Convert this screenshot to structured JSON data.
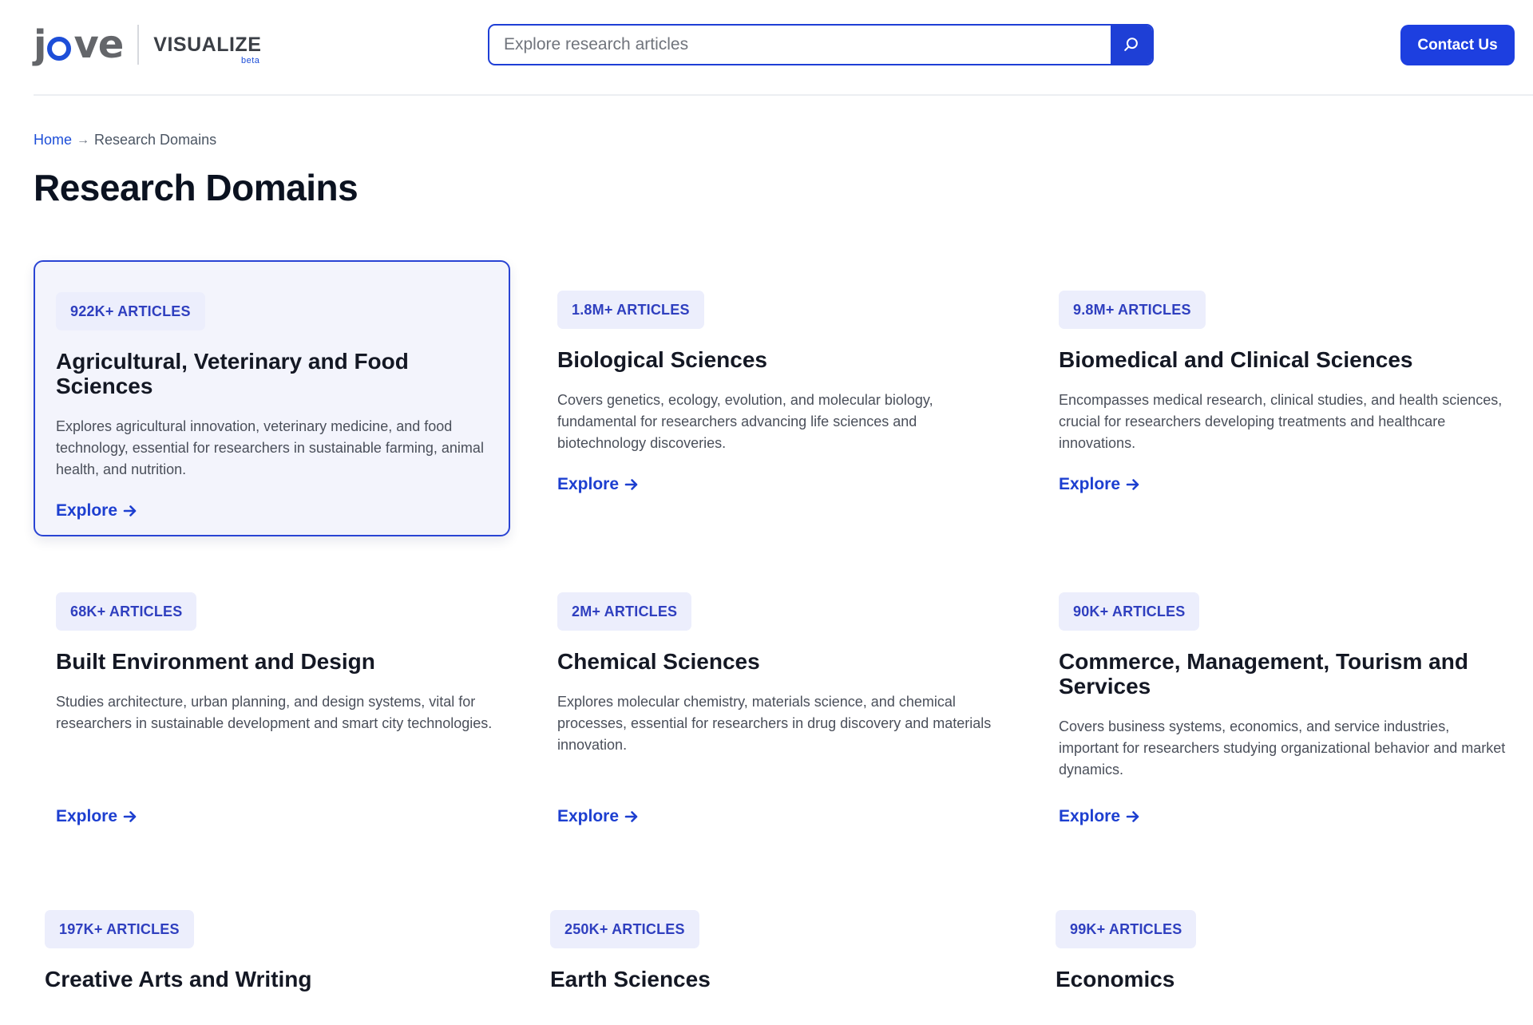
{
  "header": {
    "logo_text_j": "j",
    "logo_text_ve": "ve",
    "logo_product": "VISUALIZE",
    "logo_beta": "beta",
    "search_placeholder": "Explore research articles",
    "contact_label": "Contact Us"
  },
  "breadcrumb": {
    "home": "Home",
    "current": "Research Domains"
  },
  "page_title": "Research Domains",
  "explore_label": "Explore",
  "colors": {
    "accent": "#1d3fe0",
    "badge_bg": "#eceefc",
    "active_card_bg": "#f3f4fc"
  },
  "domains": [
    {
      "badge": "922K+ ARTICLES",
      "title": "Agricultural, Veterinary and Food Sciences",
      "description": "Explores agricultural innovation, veterinary medicine, and food technology, essential for researchers in sustainable farming, animal health, and nutrition."
    },
    {
      "badge": "1.8M+ ARTICLES",
      "title": "Biological Sciences",
      "description": "Covers genetics, ecology, evolution, and molecular biology, fundamental for researchers advancing life sciences and biotechnology discoveries."
    },
    {
      "badge": "9.8M+ ARTICLES",
      "title": "Biomedical and Clinical Sciences",
      "description": "Encompasses medical research, clinical studies, and health sciences, crucial for researchers developing treatments and healthcare innovations."
    },
    {
      "badge": "68K+ ARTICLES",
      "title": "Built Environment and Design",
      "description": "Studies architecture, urban planning, and design systems, vital for researchers in sustainable development and smart city technologies."
    },
    {
      "badge": "2M+ ARTICLES",
      "title": "Chemical Sciences",
      "description": "Explores molecular chemistry, materials science, and chemical processes, essential for researchers in drug discovery and materials innovation."
    },
    {
      "badge": "90K+ ARTICLES",
      "title": "Commerce, Management, Tourism and Services",
      "description": "Covers business systems, economics, and service industries, important for researchers studying organizational behavior and market dynamics."
    },
    {
      "badge": "197K+ ARTICLES",
      "title": "Creative Arts and Writing"
    },
    {
      "badge": "250K+ ARTICLES",
      "title": "Earth Sciences"
    },
    {
      "badge": "99K+ ARTICLES",
      "title": "Economics"
    }
  ]
}
